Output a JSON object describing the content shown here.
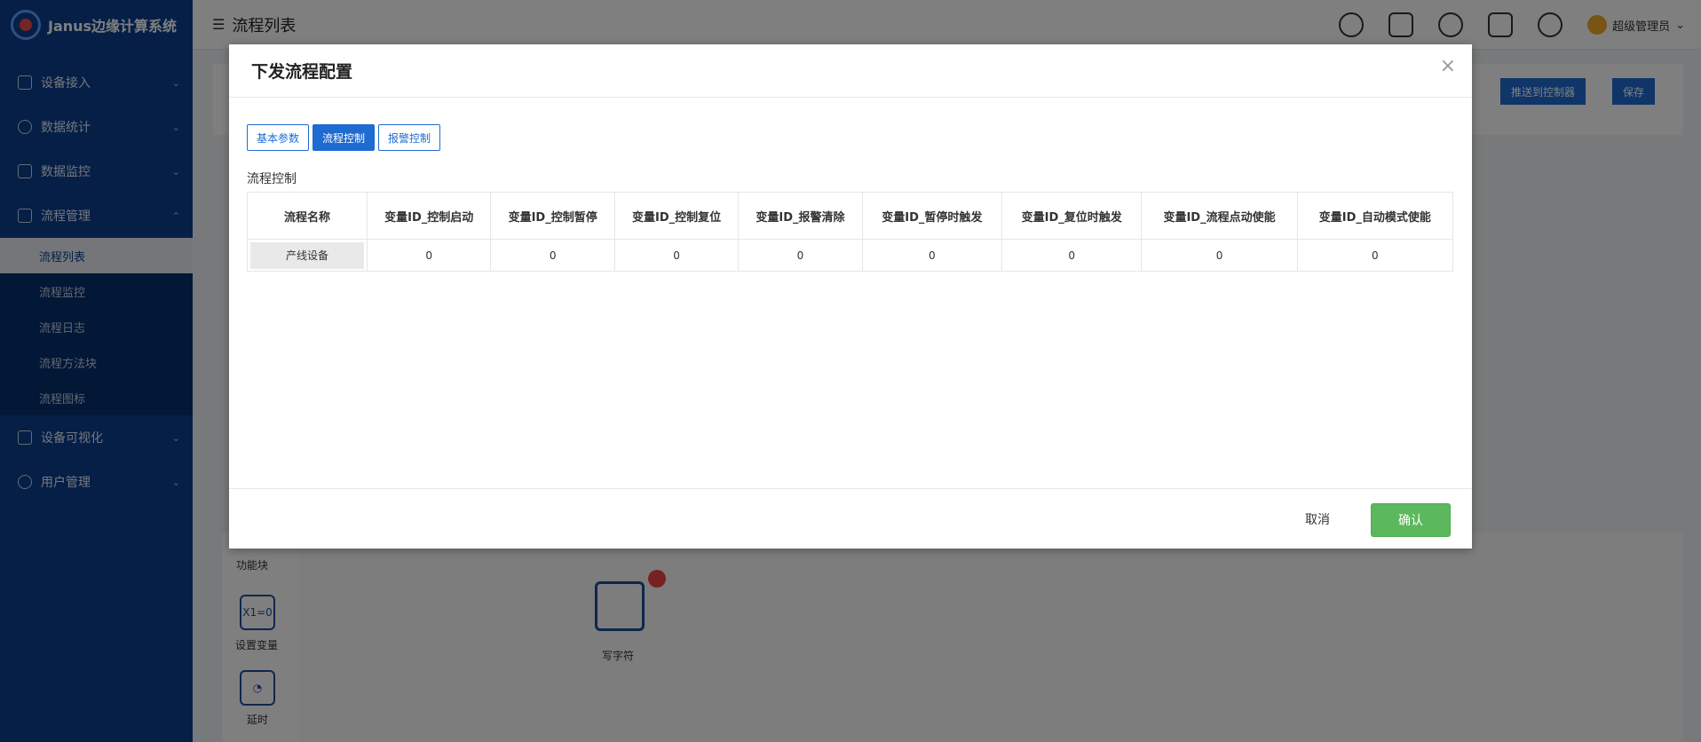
{
  "app": {
    "title": "Janus边缘计算系统"
  },
  "sidebar": {
    "items": [
      {
        "label": "设备接入",
        "icon": "device-icon"
      },
      {
        "label": "数据统计",
        "icon": "clock-icon"
      },
      {
        "label": "数据监控",
        "icon": "monitor-icon"
      },
      {
        "label": "流程管理",
        "icon": "flow-icon"
      },
      {
        "label": "设备可视化",
        "icon": "cube-icon"
      },
      {
        "label": "用户管理",
        "icon": "users-icon"
      }
    ],
    "submenu": [
      {
        "label": "流程列表",
        "active": true
      },
      {
        "label": "流程监控"
      },
      {
        "label": "流程日志"
      },
      {
        "label": "流程方法块"
      },
      {
        "label": "流程图标"
      }
    ]
  },
  "header": {
    "title": "流程列表",
    "user": "超级管理员",
    "icons": [
      "bell-icon",
      "apps-icon",
      "api-icon",
      "nodered-icon",
      "cloud-icon"
    ]
  },
  "background": {
    "buttons": {
      "push": "推送到控制器",
      "save": "保存"
    },
    "function_blocks_title": "功能块",
    "blocks": [
      {
        "glyph": "X1=0",
        "label": "设置变量"
      },
      {
        "glyph": "◔",
        "label": "延时"
      }
    ],
    "node_label": "写字符"
  },
  "modal": {
    "title": "下发流程配置",
    "tabs": [
      {
        "label": "基本参数",
        "active": false
      },
      {
        "label": "流程控制",
        "active": true
      },
      {
        "label": "报警控制",
        "active": false
      }
    ],
    "section_label": "流程控制",
    "table": {
      "headers": [
        "流程名称",
        "变量ID_控制启动",
        "变量ID_控制暂停",
        "变量ID_控制复位",
        "变量ID_报警清除",
        "变量ID_暂停时触发",
        "变量ID_复位时触发",
        "变量ID_流程点动使能",
        "变量ID_自动模式使能"
      ],
      "rows": [
        [
          "产线设备",
          "0",
          "0",
          "0",
          "0",
          "0",
          "0",
          "0",
          "0"
        ]
      ]
    },
    "cancel_label": "取消",
    "confirm_label": "确认"
  },
  "colors": {
    "sidebar": "#0a3f8f",
    "primary": "#1e6bd2",
    "confirm": "#5cb85c"
  }
}
